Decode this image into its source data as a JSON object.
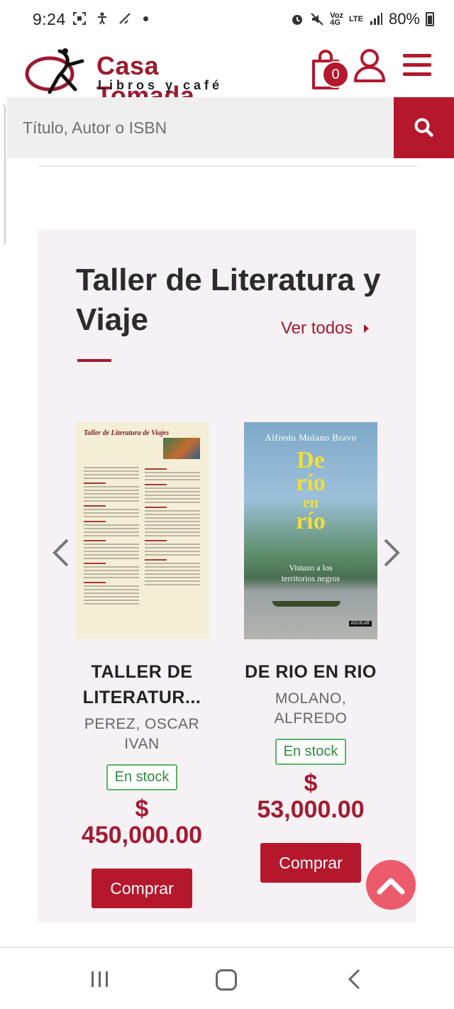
{
  "status_bar": {
    "time": "9:24",
    "battery": "80%",
    "network_top": "Voz",
    "network_bottom": "4G",
    "lte": "LTE"
  },
  "header": {
    "logo_title": "Casa Tomada",
    "logo_subtitle": "Libros y café",
    "cart_count": "0"
  },
  "search": {
    "placeholder": "Título, Autor o ISBN"
  },
  "section": {
    "title": "Taller de Literatura y Viaje",
    "see_all": "Ver todos"
  },
  "products": [
    {
      "title": "TALLER DE LITERATUR...",
      "author": "PEREZ, OSCAR IVAN",
      "stock": "En stock",
      "currency": "$",
      "price": "450,000.00",
      "buy": "Comprar",
      "cover_title": "Taller de Literatura de Viajes"
    },
    {
      "title": "DE RIO EN RIO",
      "author": "MOLANO, ALFREDO",
      "stock": "En stock",
      "currency": "$",
      "price": "53,000.00",
      "buy": "Comprar",
      "cover_author": "Alfredo Molano Bravo",
      "cover_title_1": "De",
      "cover_title_2": "río",
      "cover_title_3": "en",
      "cover_title_4": "río",
      "cover_subtitle_1": "Vistazo a los",
      "cover_subtitle_2": "territorios negros",
      "cover_publisher": "AGUILAR"
    }
  ],
  "colors": {
    "brand": "#b5172d",
    "section_bg": "#f6f1f4",
    "stock_green": "#2e8b3c",
    "scroll_top": "#ec5b6b"
  },
  "icons": [
    "qr-icon",
    "accessibility-icon",
    "mute-icon",
    "alarm-icon",
    "cart-icon",
    "user-icon",
    "menu-icon",
    "search-icon",
    "chevron-left-icon",
    "chevron-right-icon",
    "chevron-up-icon"
  ]
}
